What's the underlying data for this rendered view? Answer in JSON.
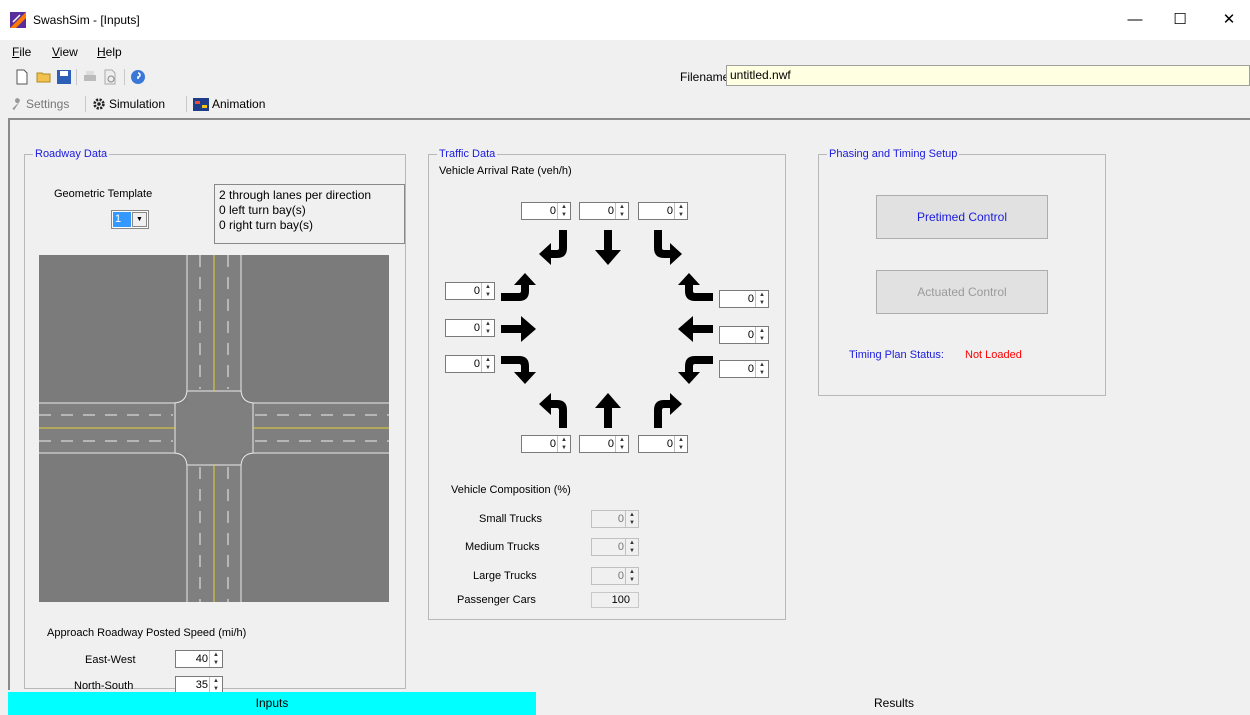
{
  "window": {
    "title": "SwashSim - [Inputs]",
    "minimize": "—",
    "maximize": "☐",
    "close": "✕"
  },
  "menu": [
    {
      "key": "F",
      "rest": "ile"
    },
    {
      "key": "V",
      "rest": "iew"
    },
    {
      "key": "H",
      "rest": "elp"
    }
  ],
  "filename": {
    "label": "Filename",
    "value": "untitled.nwf"
  },
  "toolbar2": {
    "settings": "Settings",
    "simulation": "Simulation",
    "animation": "Animation"
  },
  "roadway": {
    "legend": "Roadway Data",
    "geom_label": "Geometric Template",
    "geom_value": "1",
    "info": [
      "2 through lanes per direction",
      "0 left turn bay(s)",
      "0 right turn bay(s)"
    ],
    "speed_label": "Approach Roadway Posted Speed (mi/h)",
    "ew_label": "East-West",
    "ew_value": "40",
    "ns_label": "North-South",
    "ns_value": "35"
  },
  "traffic": {
    "legend": "Traffic Data",
    "arrival_label": "Vehicle Arrival Rate (veh/h)",
    "rates": {
      "north": [
        "0",
        "0",
        "0"
      ],
      "south": [
        "0",
        "0",
        "0"
      ],
      "west": [
        "0",
        "0",
        "0"
      ],
      "east": [
        "0",
        "0",
        "0"
      ]
    },
    "composition_label": "Vehicle Composition (%)",
    "small_trucks_label": "Small Trucks",
    "small_trucks": "0",
    "medium_trucks_label": "Medium Trucks",
    "medium_trucks": "0",
    "large_trucks_label": "Large Trucks",
    "large_trucks": "0",
    "passenger_cars_label": "Passenger Cars",
    "passenger_cars": "100"
  },
  "phasing": {
    "legend": "Phasing and Timing Setup",
    "pretimed": "Pretimed Control",
    "actuated": "Actuated Control",
    "status_label": "Timing Plan Status:",
    "status_value": "Not Loaded"
  },
  "tabs": {
    "inputs": "Inputs",
    "results": "Results"
  },
  "colors": {
    "accent": "#1a1adf",
    "active_tab": "#00ffff",
    "status_red": "#ff0000",
    "filename_bg": "#ffffe1"
  }
}
